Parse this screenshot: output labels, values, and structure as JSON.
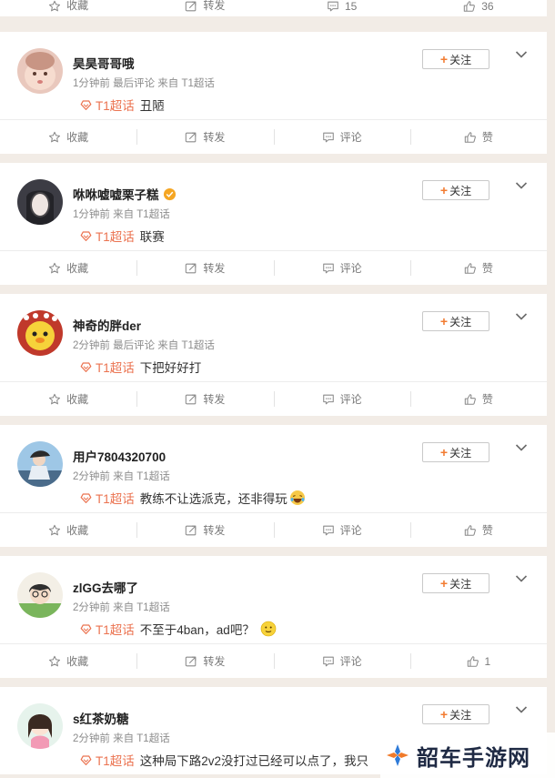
{
  "top_actionbar": {
    "favorite": "收藏",
    "repost": "转发",
    "comment": "15",
    "like": "36"
  },
  "follow_label": "关注",
  "topic_label": "T1超话",
  "posts": [
    {
      "username": "昊昊哥哥哦",
      "meta": "1分钟前 最后评论 来自 T1超话",
      "text": "丑陋",
      "actions": {
        "favorite": "收藏",
        "repost": "转发",
        "comment": "评论",
        "like": "赞"
      }
    },
    {
      "username": "咻咻嘘嘘栗子糕",
      "meta": "1分钟前 来自 T1超话",
      "text": "联赛",
      "actions": {
        "favorite": "收藏",
        "repost": "转发",
        "comment": "评论",
        "like": "赞"
      }
    },
    {
      "username": "神奇的胖der",
      "meta": "2分钟前 最后评论 来自 T1超话",
      "text": "下把好好打",
      "actions": {
        "favorite": "收藏",
        "repost": "转发",
        "comment": "评论",
        "like": "赞"
      }
    },
    {
      "username": "用户7804320700",
      "meta": "2分钟前 来自 T1超话",
      "text": "教练不让选派克，还非得玩",
      "actions": {
        "favorite": "收藏",
        "repost": "转发",
        "comment": "评论",
        "like": "赞"
      }
    },
    {
      "username": "zlGG去哪了",
      "meta": "2分钟前 来自 T1超话",
      "text": "不至于4ban，ad吧？",
      "actions": {
        "favorite": "收藏",
        "repost": "转发",
        "comment": "评论",
        "like": "1"
      }
    },
    {
      "username": "s红茶奶糖",
      "meta": "2分钟前 来自 T1超话",
      "text": "这种局下路2v2没打过已经可以点了，我只"
    }
  ],
  "watermark": "韶车手游网",
  "colors": {
    "accent": "#eb7350",
    "follow_plus": "#f27c32",
    "background": "#f2ece6"
  }
}
